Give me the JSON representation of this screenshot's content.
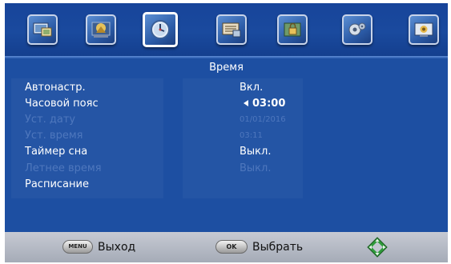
{
  "header": {
    "tabs": [
      {
        "icon": "picture-settings-icon",
        "active": false
      },
      {
        "icon": "sound-settings-icon",
        "active": false
      },
      {
        "icon": "time-settings-icon",
        "active": true
      },
      {
        "icon": "options-icon",
        "active": false
      },
      {
        "icon": "lock-settings-icon",
        "active": false
      },
      {
        "icon": "setup-icon",
        "active": false
      },
      {
        "icon": "channel-settings-icon",
        "active": false
      }
    ]
  },
  "menu": {
    "title": "Время",
    "items": [
      {
        "label": "Автонастр.",
        "value": "Вкл.",
        "enabled": true
      },
      {
        "label": "Часовой пояс",
        "value": "03:00",
        "enabled": true,
        "selected": true
      },
      {
        "label": "Уст. дату",
        "value": "01/01/2016",
        "enabled": false
      },
      {
        "label": "Уст. время",
        "value": "03:11",
        "enabled": false
      },
      {
        "label": "Таймер сна",
        "value": "Выкл.",
        "enabled": true
      },
      {
        "label": "Летнее время",
        "value": "Выкл.",
        "enabled": false
      },
      {
        "label": "Расписание",
        "value": "",
        "enabled": true
      }
    ]
  },
  "footer": {
    "menu_key": "MENU",
    "menu_label": "Выход",
    "ok_key": "OK",
    "ok_label": "Выбрать",
    "navigate_icon": "dpad-navigate-icon"
  },
  "colors": {
    "background": "#1d4fa2",
    "text": "#ffffff",
    "disabled_text": "#4e77bd",
    "footer": "#b5bac5"
  }
}
